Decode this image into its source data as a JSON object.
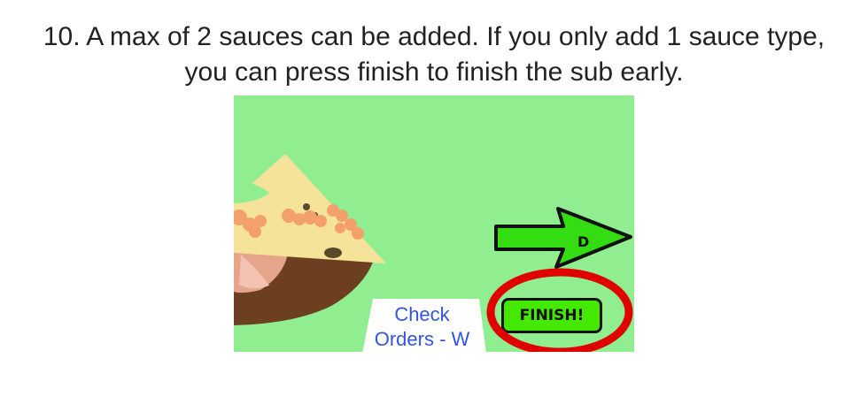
{
  "instruction": {
    "line1": "10. A max of 2 sauces can be added. If you only add 1 sauce type,",
    "line2": "you can press finish to finish the sub early."
  },
  "game": {
    "background_color": "#90ee90",
    "check_orders": {
      "line1": "Check",
      "line2": "Orders - W"
    },
    "finish_button": {
      "label": "FINISH!",
      "color": "#44e800"
    },
    "next_arrow": {
      "key": "D",
      "color": "#33dd11"
    },
    "highlight_color": "#e00000"
  }
}
